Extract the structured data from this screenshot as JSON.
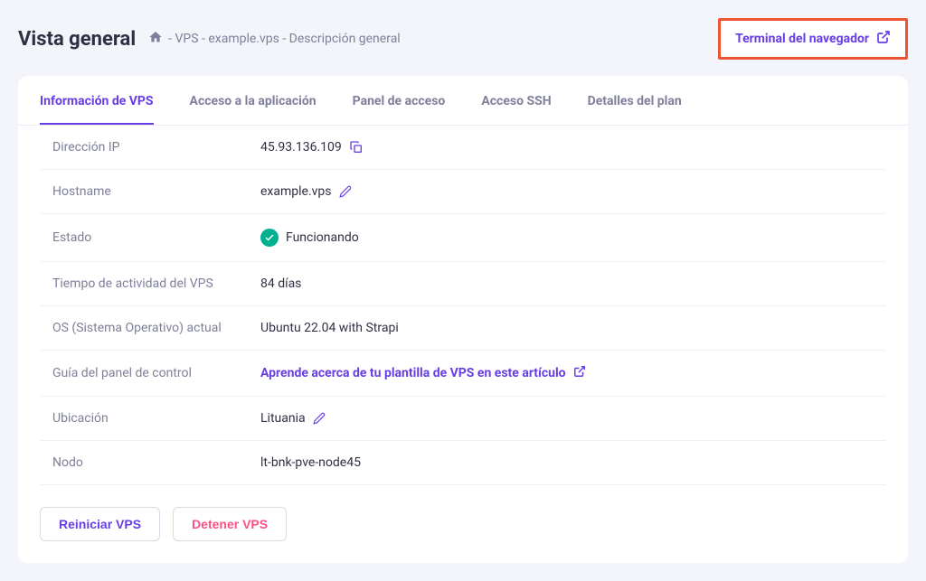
{
  "header": {
    "title": "Vista general",
    "breadcrumb": "- VPS - example.vps - Descripción general",
    "terminal_button": "Terminal del navegador"
  },
  "tabs": [
    {
      "label": "Información de VPS",
      "active": true
    },
    {
      "label": "Acceso a la aplicación",
      "active": false
    },
    {
      "label": "Panel de acceso",
      "active": false
    },
    {
      "label": "Acceso SSH",
      "active": false
    },
    {
      "label": "Detalles del plan",
      "active": false
    }
  ],
  "info": {
    "ip_label": "Dirección IP",
    "ip_value": "45.93.136.109",
    "hostname_label": "Hostname",
    "hostname_value": "example.vps",
    "status_label": "Estado",
    "status_value": "Funcionando",
    "uptime_label": "Tiempo de actividad del VPS",
    "uptime_value": "84 días",
    "os_label": "OS (Sistema Operativo) actual",
    "os_value": "Ubuntu 22.04 with Strapi",
    "guide_label": "Guía del panel de control",
    "guide_value": "Aprende acerca de tu plantilla de VPS en este artículo",
    "location_label": "Ubicación",
    "location_value": "Lituania",
    "node_label": "Nodo",
    "node_value": "lt-bnk-pve-node45"
  },
  "actions": {
    "restart": "Reiniciar VPS",
    "stop": "Detener VPS"
  }
}
